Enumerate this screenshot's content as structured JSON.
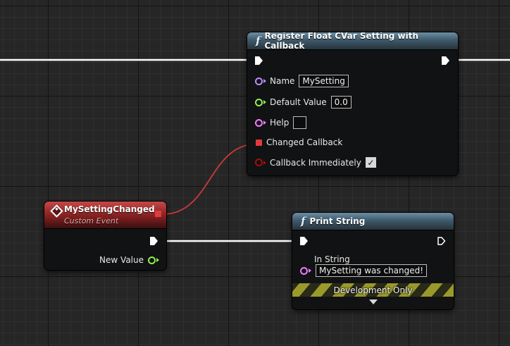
{
  "colors": {
    "exec_wire": "#ffffff",
    "delegate_wire": "#c83b3b",
    "string_pin": "#f27cff",
    "name_pin": "#b88dff",
    "float_pin": "#8ef04e",
    "bool_pin": "#a10f0f"
  },
  "register_node": {
    "title": "Register Float CVar Setting with Callback",
    "title_icon": "function-icon",
    "name_label": "Name",
    "name_value": "MySetting",
    "default_label": "Default Value",
    "default_value": "0.0",
    "help_label": "Help",
    "help_value": "",
    "changed_callback_label": "Changed Callback",
    "callback_immediately_label": "Callback Immediately",
    "callback_immediately_checked": true
  },
  "event_node": {
    "title": "MySettingChanged",
    "subtitle": "Custom Event",
    "title_icon": "custom-event-icon",
    "output_label": "New Value"
  },
  "print_node": {
    "title": "Print String",
    "title_icon": "function-icon",
    "in_string_label": "In String",
    "in_string_value": "MySetting was changed!",
    "development_label": "Development Only",
    "advanced_icon": "chevron-down-icon"
  }
}
